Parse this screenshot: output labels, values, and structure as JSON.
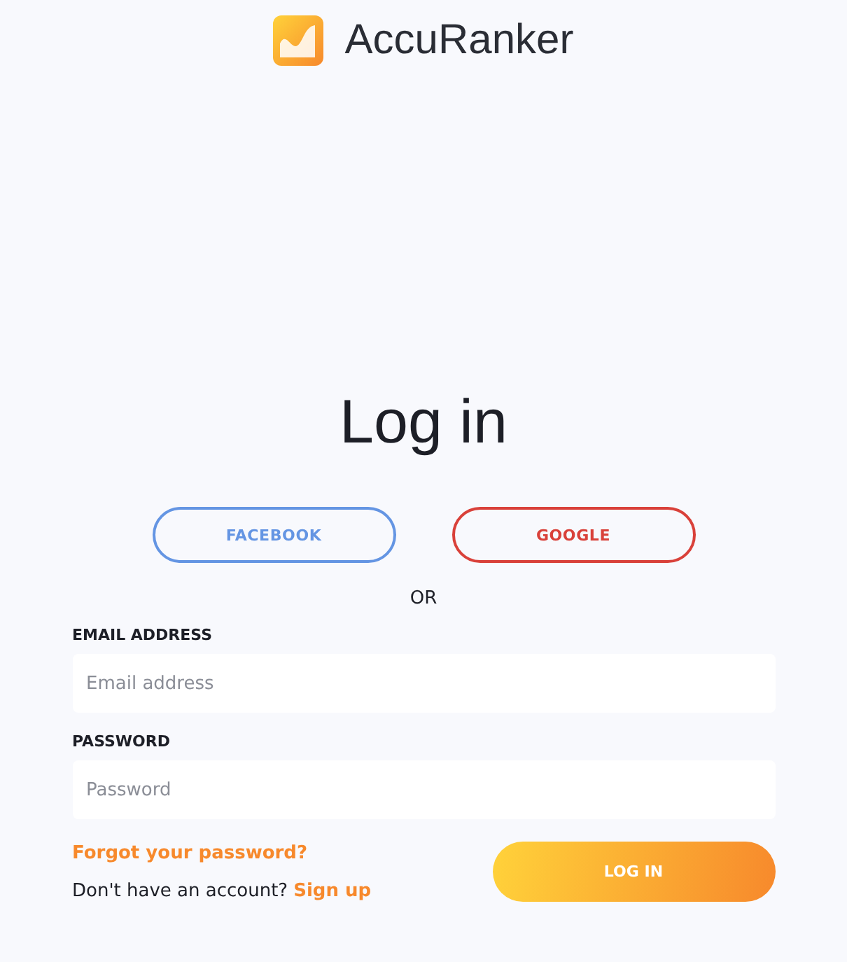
{
  "brand": {
    "name": "AccuRanker"
  },
  "title": "Log in",
  "social_buttons": [
    {
      "label": "FACEBOOK",
      "kind": "facebook"
    },
    {
      "label": "GOOGLE",
      "kind": "google"
    }
  ],
  "separator": "OR",
  "fields": [
    {
      "label": "EMAIL ADDRESS",
      "placeholder": "Email address"
    },
    {
      "label": "PASSWORD",
      "placeholder": "Password"
    }
  ],
  "forgot_link": "Forgot your password?",
  "signup_prompt": "Don't have an account?",
  "signup_link": "Sign up",
  "submit_button": "LOG IN"
}
